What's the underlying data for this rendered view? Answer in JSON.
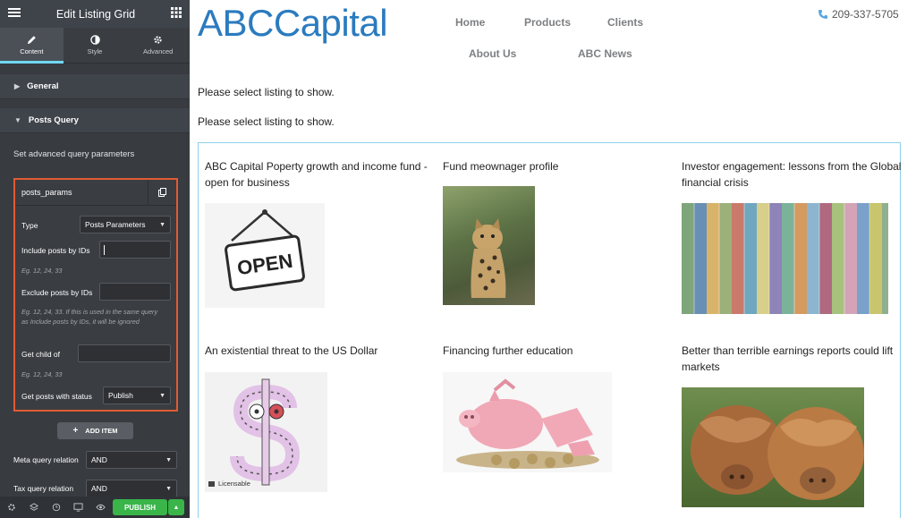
{
  "panel": {
    "title": "Edit Listing Grid",
    "tabs": [
      {
        "label": "Content",
        "icon": "pencil-icon",
        "active": true
      },
      {
        "label": "Style",
        "icon": "half-circle-icon",
        "active": false
      },
      {
        "label": "Advanced",
        "icon": "gear-icon",
        "active": false
      }
    ],
    "sections": {
      "general": "General",
      "posts_query": "Posts Query"
    },
    "description": "Set advanced query parameters",
    "repeater": {
      "item_title": "posts_params",
      "type_label": "Type",
      "type_value": "Posts Parameters",
      "include_label": "Include posts by IDs",
      "include_value": "",
      "include_hint": "Eg. 12, 24, 33",
      "exclude_label": "Exclude posts by IDs",
      "exclude_value": "",
      "exclude_hint": "Eg. 12, 24, 33. If this is used in the same query as Include posts by IDs, it will be ignored",
      "child_label": "Get child of",
      "child_value": "",
      "child_hint": "Eg. 12, 24, 33",
      "status_label": "Get posts with status",
      "status_value": "Publish"
    },
    "add_item_label": "ADD ITEM",
    "meta_relation_label": "Meta query relation",
    "meta_relation_value": "AND",
    "tax_relation_label": "Tax query relation",
    "tax_relation_value": "AND",
    "publish_label": "PUBLISH",
    "accent_color": "#71d7f7",
    "highlight_color": "#e25b33",
    "publish_color": "#39b54a"
  },
  "site": {
    "logo_part1": "ABC",
    "logo_part2": "Capital",
    "nav": [
      "Home",
      "Products",
      "Clients",
      "About Us",
      "ABC News"
    ],
    "phone": "209-337-5705",
    "messages": [
      "Please select listing to show.",
      "Please select listing to show."
    ],
    "cards": [
      {
        "title": "ABC Capital Poperty growth and income fund - open for business",
        "image": "open-sign-image",
        "image_text": "OPEN"
      },
      {
        "title": "Fund meownager profile",
        "image": "ocelot-image"
      },
      {
        "title": "Investor engagement: lessons from the Global financial crisis",
        "image": "banknotes-image"
      },
      {
        "title": "An existential threat to the US Dollar",
        "image": "dollar-sign-image",
        "badge": "Licensable"
      },
      {
        "title": "Financing further education",
        "image": "broken-piggy-bank-image"
      },
      {
        "title": "Better than terrible earnings reports could lift markets",
        "image": "highland-cattle-image"
      }
    ],
    "brand_color": "#2b7bbf"
  }
}
